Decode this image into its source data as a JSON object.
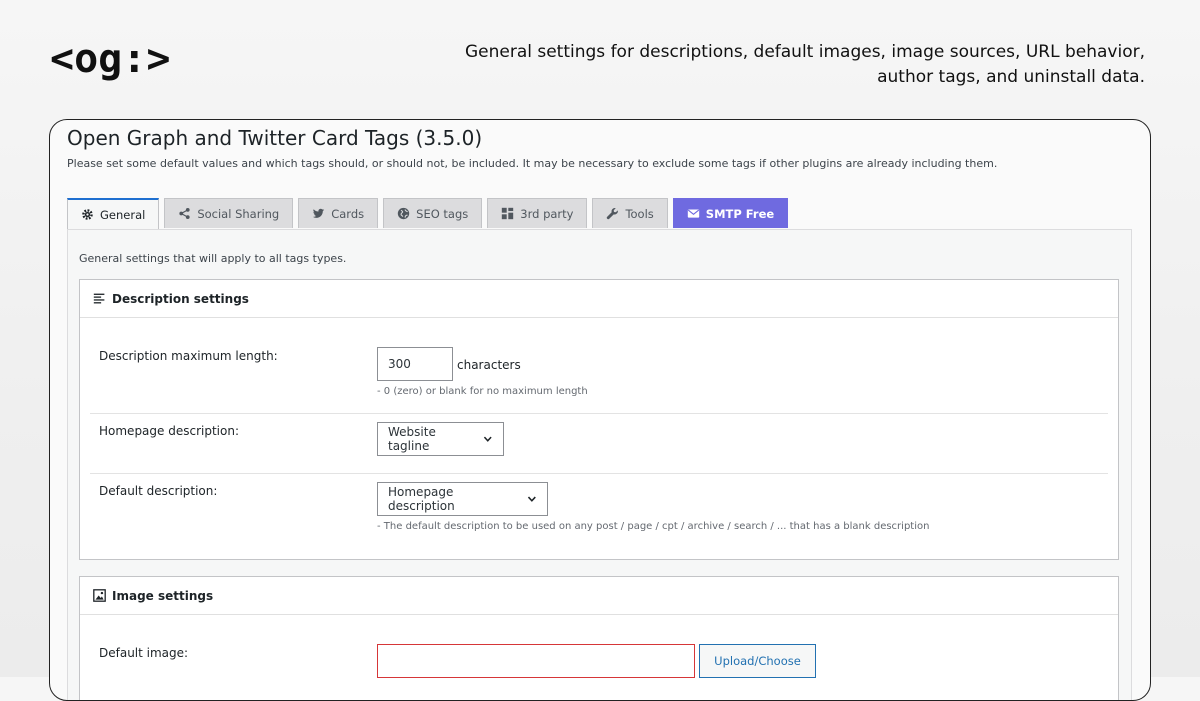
{
  "logo": "<og:>",
  "tagline": "General settings for descriptions, default images, image sources, URL behavior, author tags, and uninstall data.",
  "page": {
    "title": "Open Graph and Twitter Card Tags (3.5.0)",
    "description": "Please set some default values and which tags should, or should not, be included. It may be necessary to exclude some tags if other plugins are already including them."
  },
  "tabs": [
    {
      "label": "General",
      "icon": "gear-icon"
    },
    {
      "label": "Social Sharing",
      "icon": "share-icon"
    },
    {
      "label": "Cards",
      "icon": "twitter-bird-icon"
    },
    {
      "label": "SEO tags",
      "icon": "globe-icon"
    },
    {
      "label": "3rd party",
      "icon": "grid-icon"
    },
    {
      "label": "Tools",
      "icon": "wrench-icon"
    },
    {
      "label": "SMTP Free",
      "icon": "mail-icon"
    }
  ],
  "panel_intro": "General settings that will apply to all tags types.",
  "description_settings": {
    "heading": "Description settings",
    "max_length_label": "Description maximum length:",
    "max_length_value": "300",
    "max_length_unit": "characters",
    "max_length_hint": "- 0 (zero) or blank for no maximum length",
    "homepage_label": "Homepage description:",
    "homepage_value": "Website tagline",
    "default_label": "Default description:",
    "default_value": "Homepage description",
    "default_hint": "- The default description to be used on any post / page / cpt / archive / search / ... that has a blank description"
  },
  "image_settings": {
    "heading": "Image settings",
    "default_image_label": "Default image:",
    "default_image_value": "",
    "upload_button": "Upload/Choose"
  },
  "colors": {
    "active_tab_border": "#1e6fd0",
    "smtp_tab": "#6f6ae0",
    "error_border": "#d63638",
    "link_blue": "#2271b1"
  }
}
